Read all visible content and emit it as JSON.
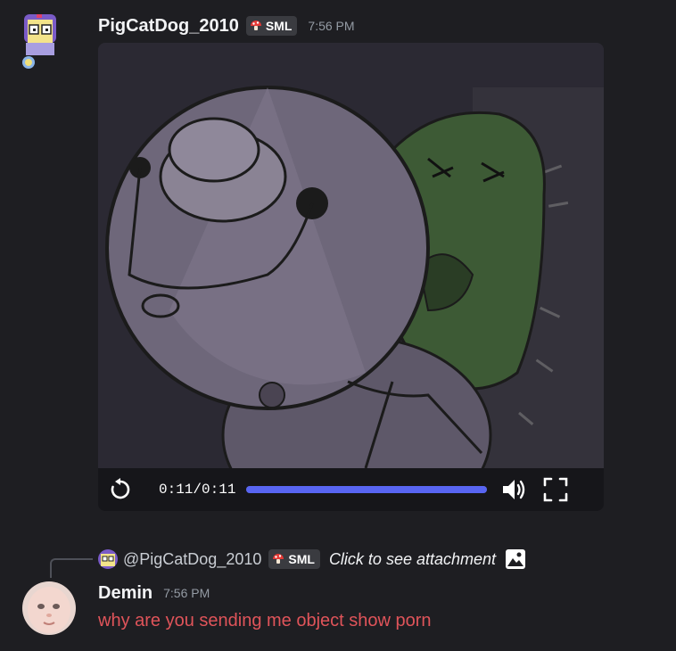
{
  "message1": {
    "username": "PigCatDog_2010",
    "tag": "SML",
    "timestamp": "7:56 PM",
    "avatar_icon": "pixel-cat-avatar-icon",
    "video": {
      "current_time": "0:11",
      "separator": "/",
      "duration": "0:11",
      "progress": 1.0,
      "progress_color": "#5865f2"
    }
  },
  "reply": {
    "mention": "@PigCatDog_2010",
    "tag": "SML",
    "attachment_text": "Click to see attachment",
    "attachment_icon": "image-icon"
  },
  "message2": {
    "username": "Demin",
    "timestamp": "7:56 PM",
    "text": "why are you sending me object show porn",
    "text_color": "#e0545a"
  }
}
